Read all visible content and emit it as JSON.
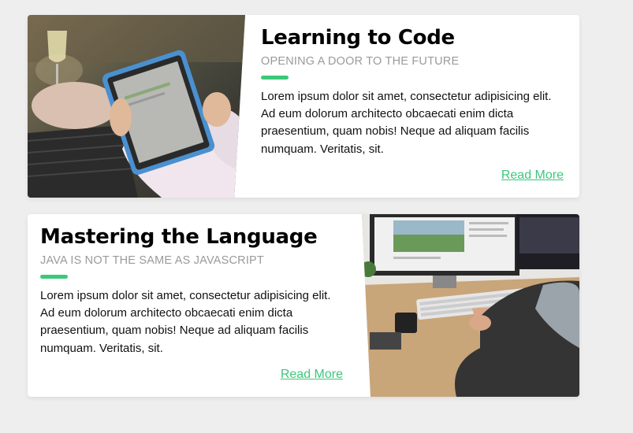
{
  "cards": [
    {
      "title": "Learning to Code",
      "subtitle": "OPENING A DOOR TO THE FUTURE",
      "body": "Lorem ipsum dolor sit amet, consectetur adipisicing elit. Ad eum dolorum architecto obcaecati enim dicta praesentium, quam nobis! Neque ad aliquam facilis numquam. Veritatis, sit.",
      "link": "Read More",
      "image_icon": "tablet-photo"
    },
    {
      "title": "Mastering the Language",
      "subtitle": "JAVA IS NOT THE SAME AS JAVASCRIPT",
      "body": "Lorem ipsum dolor sit amet, consectetur adipisicing elit. Ad eum dolorum architecto obcaecati enim dicta praesentium, quam nobis! Neque ad aliquam facilis numquam. Veritatis, sit.",
      "link": "Read More",
      "image_icon": "desk-computer-photo"
    }
  ],
  "colors": {
    "accent": "#3cc87a",
    "background": "#eeeeee",
    "card": "#ffffff",
    "subtitle": "#9a9a9a"
  }
}
